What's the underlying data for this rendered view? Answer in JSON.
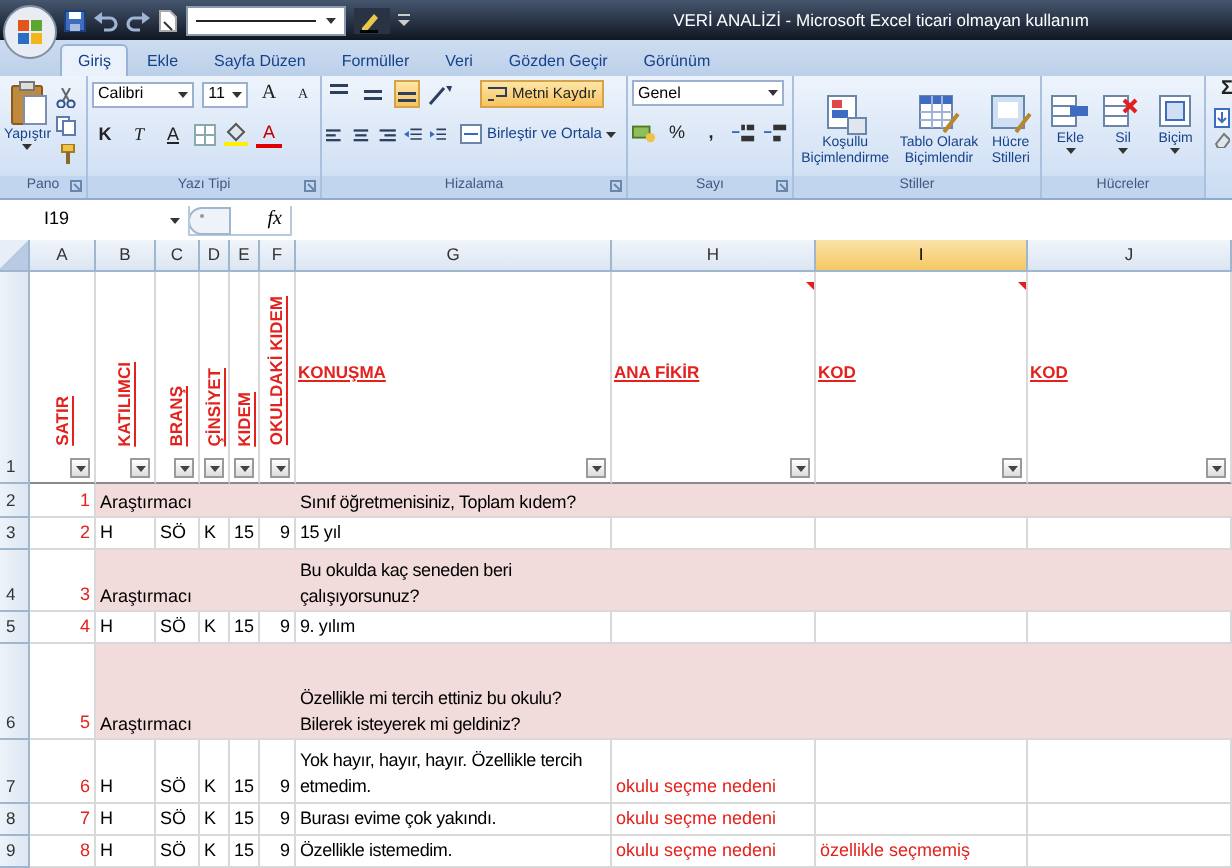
{
  "title_bar": {
    "title": "VERİ ANALİZİ - Microsoft Excel ticari olmayan kullanım"
  },
  "ribbon_tabs": [
    {
      "label": "Giriş",
      "selected": true
    },
    {
      "label": "Ekle",
      "selected": false
    },
    {
      "label": "Sayfa Düzen",
      "selected": false
    },
    {
      "label": "Formüller",
      "selected": false
    },
    {
      "label": "Veri",
      "selected": false
    },
    {
      "label": "Gözden Geçir",
      "selected": false
    },
    {
      "label": "Görünüm",
      "selected": false
    }
  ],
  "ribbon": {
    "clipboard": {
      "label": "Pano",
      "paste": "Yapıştır"
    },
    "font": {
      "label": "Yazı Tipi",
      "font_name": "Calibri",
      "font_size": "11",
      "grow": "A",
      "shrink": "A",
      "bold": "K",
      "italic": "T",
      "underline": "A",
      "font_color": "A"
    },
    "alignment": {
      "label": "Hizalama",
      "vertical_align": [
        {
          "selected": false
        },
        {
          "selected": false
        },
        {
          "selected": true
        }
      ],
      "wrap_text": {
        "label": "Metni Kaydır",
        "on": true
      },
      "merge": "Birleştir ve Ortala"
    },
    "number": {
      "label": "Sayı",
      "format": "Genel",
      "percent": "%",
      "comma": ","
    },
    "styles": {
      "label": "Stiller",
      "buttons": [
        {
          "lines": [
            "Koşullu",
            "Biçimlendirme"
          ]
        },
        {
          "lines": [
            "Tablo Olarak",
            "Biçimlendir"
          ]
        },
        {
          "lines": [
            "Hücre",
            "Stilleri"
          ]
        }
      ]
    },
    "cells": {
      "label": "Hücreler",
      "buttons": [
        "Ekle",
        "Sil",
        "Biçim"
      ]
    },
    "editing": {
      "sum": "Σ"
    }
  },
  "formula_bar": {
    "name_box": "I19",
    "function_label": "fx"
  },
  "sheet": {
    "columns": [
      {
        "letter": "A",
        "selected": false
      },
      {
        "letter": "B",
        "selected": false
      },
      {
        "letter": "C",
        "selected": false
      },
      {
        "letter": "D",
        "selected": false
      },
      {
        "letter": "E",
        "selected": false
      },
      {
        "letter": "F",
        "selected": false
      },
      {
        "letter": "G",
        "selected": false
      },
      {
        "letter": "H",
        "selected": false
      },
      {
        "letter": "I",
        "selected": true
      },
      {
        "letter": "J",
        "selected": false
      }
    ],
    "header_row": {
      "number": "1",
      "cells": [
        {
          "text": "SATIR",
          "kind": "vertical",
          "has_comment": false
        },
        {
          "text": "KATILIMCI",
          "kind": "vertical",
          "has_comment": false
        },
        {
          "text": "BRANŞ",
          "kind": "vertical",
          "has_comment": false
        },
        {
          "text": "ÇİNSİYET",
          "kind": "vertical",
          "has_comment": false
        },
        {
          "text": "KIDEM",
          "kind": "vertical",
          "has_comment": false
        },
        {
          "text": "OKULDAKİ KIDEM",
          "kind": "vertical",
          "has_comment": false
        },
        {
          "text": "KONUŞMA",
          "kind": "horizontal",
          "has_comment": false
        },
        {
          "text": "ANA FİKİR",
          "kind": "horizontal",
          "has_comment": true
        },
        {
          "text": "KOD",
          "kind": "horizontal",
          "has_comment": true
        },
        {
          "text": "KOD",
          "kind": "horizontal",
          "has_comment": false
        }
      ]
    },
    "rows": [
      {
        "number": "2",
        "highlighted": true,
        "cells": {
          "satir": "1",
          "katilimci": "Araştırmacı",
          "konusma": "Sınıf öğretmenisiniz, Toplam kıdem?"
        }
      },
      {
        "number": "3",
        "highlighted": false,
        "cells": {
          "satir": "2",
          "katilimci": "H",
          "brans": "SÖ",
          "cinsiyet": "K",
          "kidem": "15",
          "okuldaki_kidem": "9",
          "konusma": "15 yıl"
        }
      },
      {
        "number": "4",
        "highlighted": true,
        "cells": {
          "satir": "3",
          "katilimci": "Araştırmacı",
          "konusma": "Bu okulda kaç seneden beri\nçalışıyorsunuz?"
        }
      },
      {
        "number": "5",
        "highlighted": false,
        "cells": {
          "satir": "4",
          "katilimci": "H",
          "brans": "SÖ",
          "cinsiyet": "K",
          "kidem": "15",
          "okuldaki_kidem": "9",
          "konusma": "9. yılım"
        }
      },
      {
        "number": "6",
        "highlighted": true,
        "cells": {
          "satir": "5",
          "katilimci": "Araştırmacı",
          "konusma": "Özellikle mi tercih ettiniz bu okulu?\nBilerek isteyerek mi geldiniz?"
        }
      },
      {
        "number": "7",
        "highlighted": false,
        "cells": {
          "satir": "6",
          "katilimci": "H",
          "brans": "SÖ",
          "cinsiyet": "K",
          "kidem": "15",
          "okuldaki_kidem": "9",
          "konusma": "Yok hayır, hayır, hayır. Özellikle tercih\netmedim.",
          "ana_fikir": "okulu seçme nedeni"
        }
      },
      {
        "number": "8",
        "highlighted": false,
        "cells": {
          "satir": "7",
          "katilimci": "H",
          "brans": "SÖ",
          "cinsiyet": "K",
          "kidem": "15",
          "okuldaki_kidem": "9",
          "konusma": "Burası evime çok yakındı.",
          "ana_fikir": "okulu seçme nedeni"
        }
      },
      {
        "number": "9",
        "highlighted": false,
        "cells": {
          "satir": "8",
          "katilimci": "H",
          "brans": "SÖ",
          "cinsiyet": "K",
          "kidem": "15",
          "okuldaki_kidem": "9",
          "konusma": "Özellikle istemedim.",
          "ana_fikir": "okulu seçme nedeni",
          "kod_1": "özellikle seçmemiş"
        }
      }
    ]
  }
}
